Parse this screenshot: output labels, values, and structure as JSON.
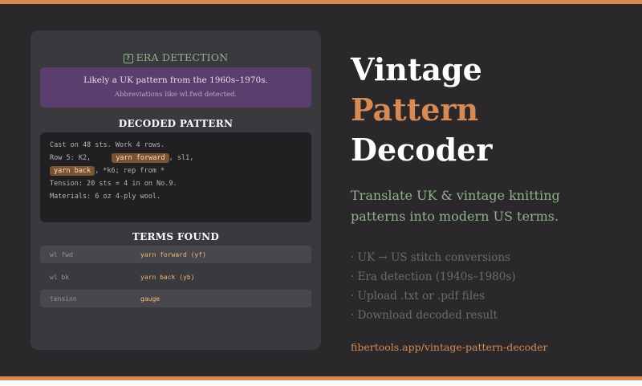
{
  "colors": {
    "accent": "#d88a54",
    "green": "#8fb28a",
    "era_box": "#5a3f6e",
    "highlight": "#7a5430",
    "term_us": "#f0b67a"
  },
  "era": {
    "icon": "question-icon",
    "icon_glyph": "?",
    "title": "ERA DETECTION",
    "main": "Likely a UK pattern from the 1960s–1970s.",
    "sub": "Abbreviations like wl.fwd detected."
  },
  "decoded": {
    "title": "DECODED PATTERN",
    "line1": "Cast on 48 sts. Work 4 rows.",
    "line2_pre": "Row 5: K2,",
    "line2_hl": "yarn forward",
    "line2_post": ", sl1,",
    "line3_hl": "yarn back",
    "line3_post": ", *k6; rep from *",
    "line4": "Tension: 20 sts = 4 in on No.9.",
    "line5": "Materials: 6 oz 4-ply wool."
  },
  "terms": {
    "title": "TERMS FOUND",
    "rows": [
      {
        "uk": "wl fwd",
        "us": "yarn forward (yf)"
      },
      {
        "uk": "wl bk",
        "us": "yarn back (yb)"
      },
      {
        "uk": "tension",
        "us": "gauge"
      }
    ]
  },
  "hero": {
    "line1": "Vintage",
    "line2": "Pattern",
    "line3": "Decoder"
  },
  "tagline": {
    "line1": "Translate UK & vintage knitting",
    "line2": "patterns into modern US terms."
  },
  "features": [
    "· UK → US stitch conversions",
    "· Era detection (1940s–1980s)",
    "· Upload .txt or .pdf files",
    "· Download decoded result"
  ],
  "link": "fibertools.app/vintage-pattern-decoder"
}
